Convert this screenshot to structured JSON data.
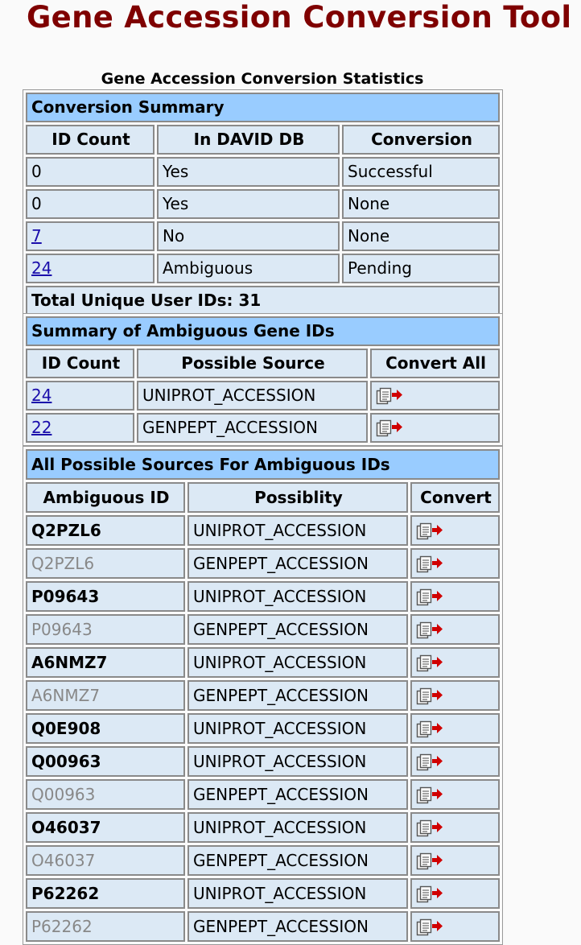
{
  "app_title": "Gene Accession Conversion Tool",
  "stats_title": "Gene Accession Conversion Statistics",
  "conversion_summary": {
    "title": "Conversion Summary",
    "headers": [
      "ID Count",
      "In DAVID DB",
      "Conversion"
    ],
    "rows": [
      {
        "count": "0",
        "in_db": "Yes",
        "conversion": "Successful",
        "link": false
      },
      {
        "count": "0",
        "in_db": "Yes",
        "conversion": "None",
        "link": false
      },
      {
        "count": "7",
        "in_db": "No",
        "conversion": "None",
        "link": true
      },
      {
        "count": "24",
        "in_db": "Ambiguous",
        "conversion": "Pending",
        "link": true
      }
    ],
    "total": "Total Unique User IDs: 31"
  },
  "ambiguous_summary": {
    "title": "Summary of Ambiguous Gene IDs",
    "headers": [
      "ID Count",
      "Possible Source",
      "Convert All"
    ],
    "rows": [
      {
        "count": "24",
        "source": "UNIPROT_ACCESSION"
      },
      {
        "count": "22",
        "source": "GENPEPT_ACCESSION"
      }
    ]
  },
  "all_sources": {
    "title": "All Possible Sources For Ambiguous IDs",
    "headers": [
      "Ambiguous ID",
      "Possiblity",
      "Convert"
    ],
    "rows": [
      {
        "id": "Q2PZL6",
        "possibility": "UNIPROT_ACCESSION",
        "primary": true
      },
      {
        "id": "Q2PZL6",
        "possibility": "GENPEPT_ACCESSION",
        "primary": false
      },
      {
        "id": "P09643",
        "possibility": "UNIPROT_ACCESSION",
        "primary": true
      },
      {
        "id": "P09643",
        "possibility": "GENPEPT_ACCESSION",
        "primary": false
      },
      {
        "id": "A6NMZ7",
        "possibility": "UNIPROT_ACCESSION",
        "primary": true
      },
      {
        "id": "A6NMZ7",
        "possibility": "GENPEPT_ACCESSION",
        "primary": false
      },
      {
        "id": "Q0E908",
        "possibility": "UNIPROT_ACCESSION",
        "primary": true
      },
      {
        "id": "Q00963",
        "possibility": "UNIPROT_ACCESSION",
        "primary": true
      },
      {
        "id": "Q00963",
        "possibility": "GENPEPT_ACCESSION",
        "primary": false
      },
      {
        "id": "O46037",
        "possibility": "UNIPROT_ACCESSION",
        "primary": true
      },
      {
        "id": "O46037",
        "possibility": "GENPEPT_ACCESSION",
        "primary": false
      },
      {
        "id": "P62262",
        "possibility": "UNIPROT_ACCESSION",
        "primary": true
      },
      {
        "id": "P62262",
        "possibility": "GENPEPT_ACCESSION",
        "primary": false
      }
    ]
  },
  "icons": {
    "convert": "copy-convert-icon"
  },
  "colors": {
    "title": "#7f0000",
    "section_header": "#99ccff",
    "cell": "#dce9f5",
    "link": "#1a0dab",
    "arrow": "#d00000"
  }
}
